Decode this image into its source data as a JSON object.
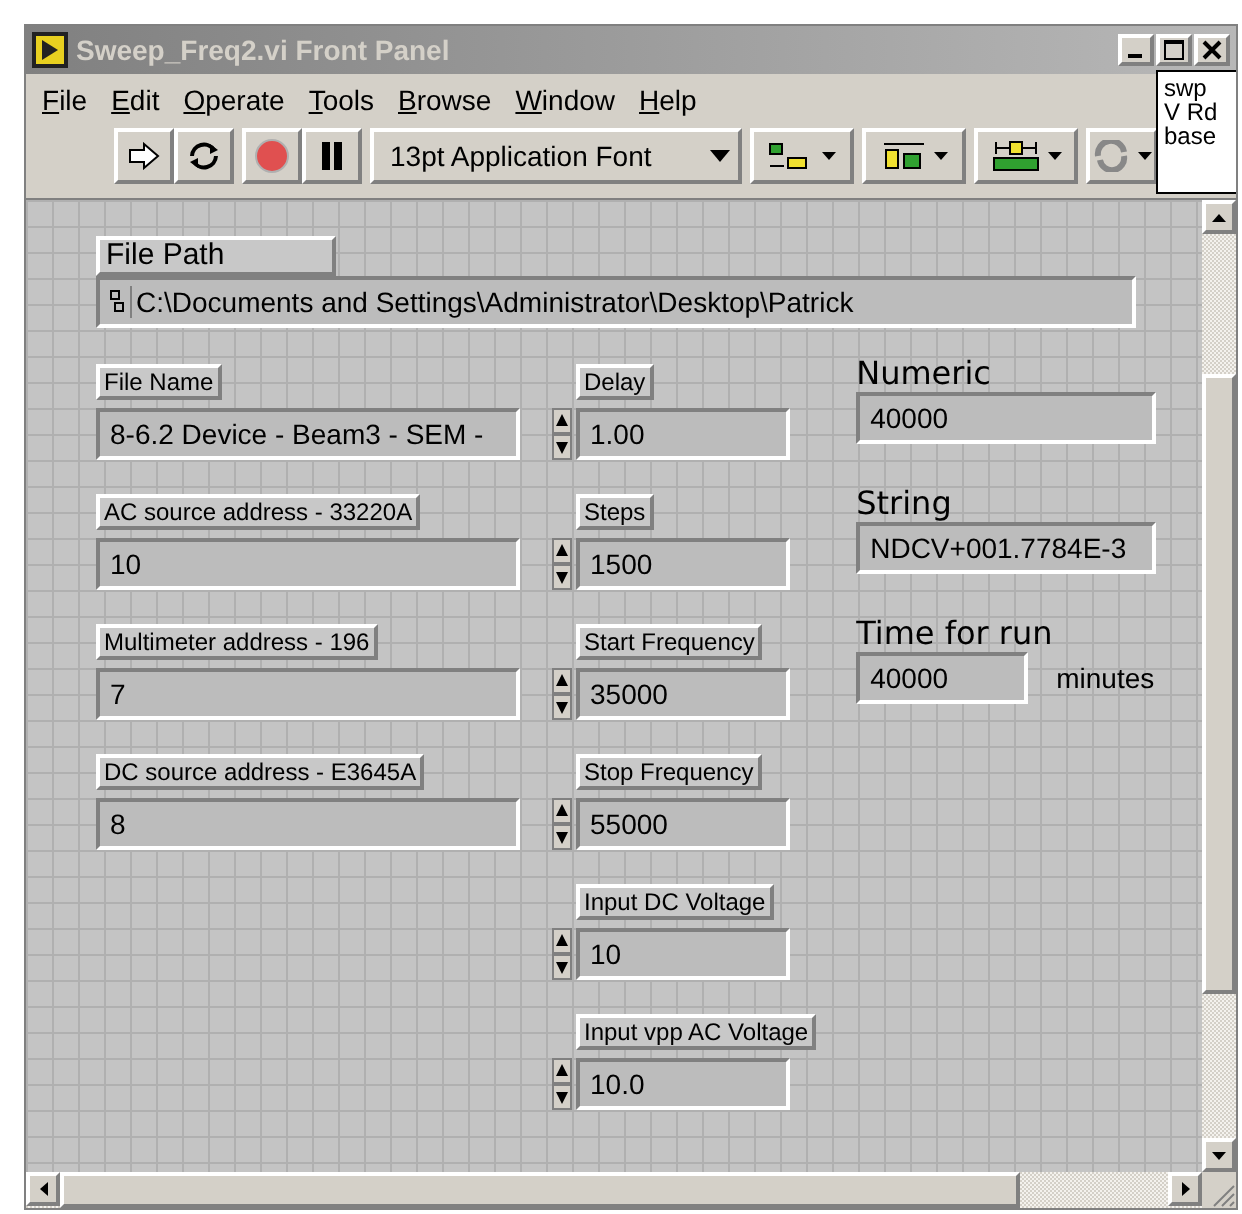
{
  "window": {
    "title": "Sweep_Freq2.vi Front Panel"
  },
  "menu": [
    {
      "label": "File"
    },
    {
      "label": "Edit"
    },
    {
      "label": "Operate"
    },
    {
      "label": "Tools"
    },
    {
      "label": "Browse"
    },
    {
      "label": "Window"
    },
    {
      "label": "Help"
    }
  ],
  "toolbar": {
    "font_selector": "13pt Application Font",
    "vi_icon_text": [
      "swp",
      "V Rd",
      "base"
    ]
  },
  "file_path": {
    "label": "File Path",
    "value": "C:\\Documents and Settings\\Administrator\\Desktop\\Patrick"
  },
  "columns": [
    {
      "items": [
        {
          "kind": "string_control",
          "label": "File Name",
          "value": "8-6.2 Device - Beam3 - SEM -"
        },
        {
          "kind": "string_control",
          "label": "AC source address - 33220A",
          "value": "10"
        },
        {
          "kind": "string_control",
          "label": "Multimeter address - 196",
          "value": "7"
        },
        {
          "kind": "string_control",
          "label": "DC source address - E3645A",
          "value": "8"
        }
      ]
    },
    {
      "items": [
        {
          "kind": "numeric_control",
          "label": "Delay",
          "value": "1.00"
        },
        {
          "kind": "numeric_control",
          "label": "Steps",
          "value": "1500"
        },
        {
          "kind": "numeric_control",
          "label": "Start Frequency",
          "value": "35000"
        },
        {
          "kind": "numeric_control",
          "label": "Stop Frequency",
          "value": "55000"
        },
        {
          "kind": "numeric_control",
          "label": "Input DC Voltage",
          "value": "10"
        },
        {
          "kind": "numeric_control",
          "label": "Input vpp AC Voltage",
          "value": "10.0"
        }
      ]
    },
    {
      "items": [
        {
          "kind": "indicator",
          "label": "Numeric",
          "value": "40000"
        },
        {
          "kind": "indicator",
          "label": "String",
          "value": "NDCV+001.7784E-3"
        },
        {
          "kind": "indicator",
          "label": "Time for run",
          "value": "40000",
          "unit": "minutes"
        }
      ]
    }
  ]
}
